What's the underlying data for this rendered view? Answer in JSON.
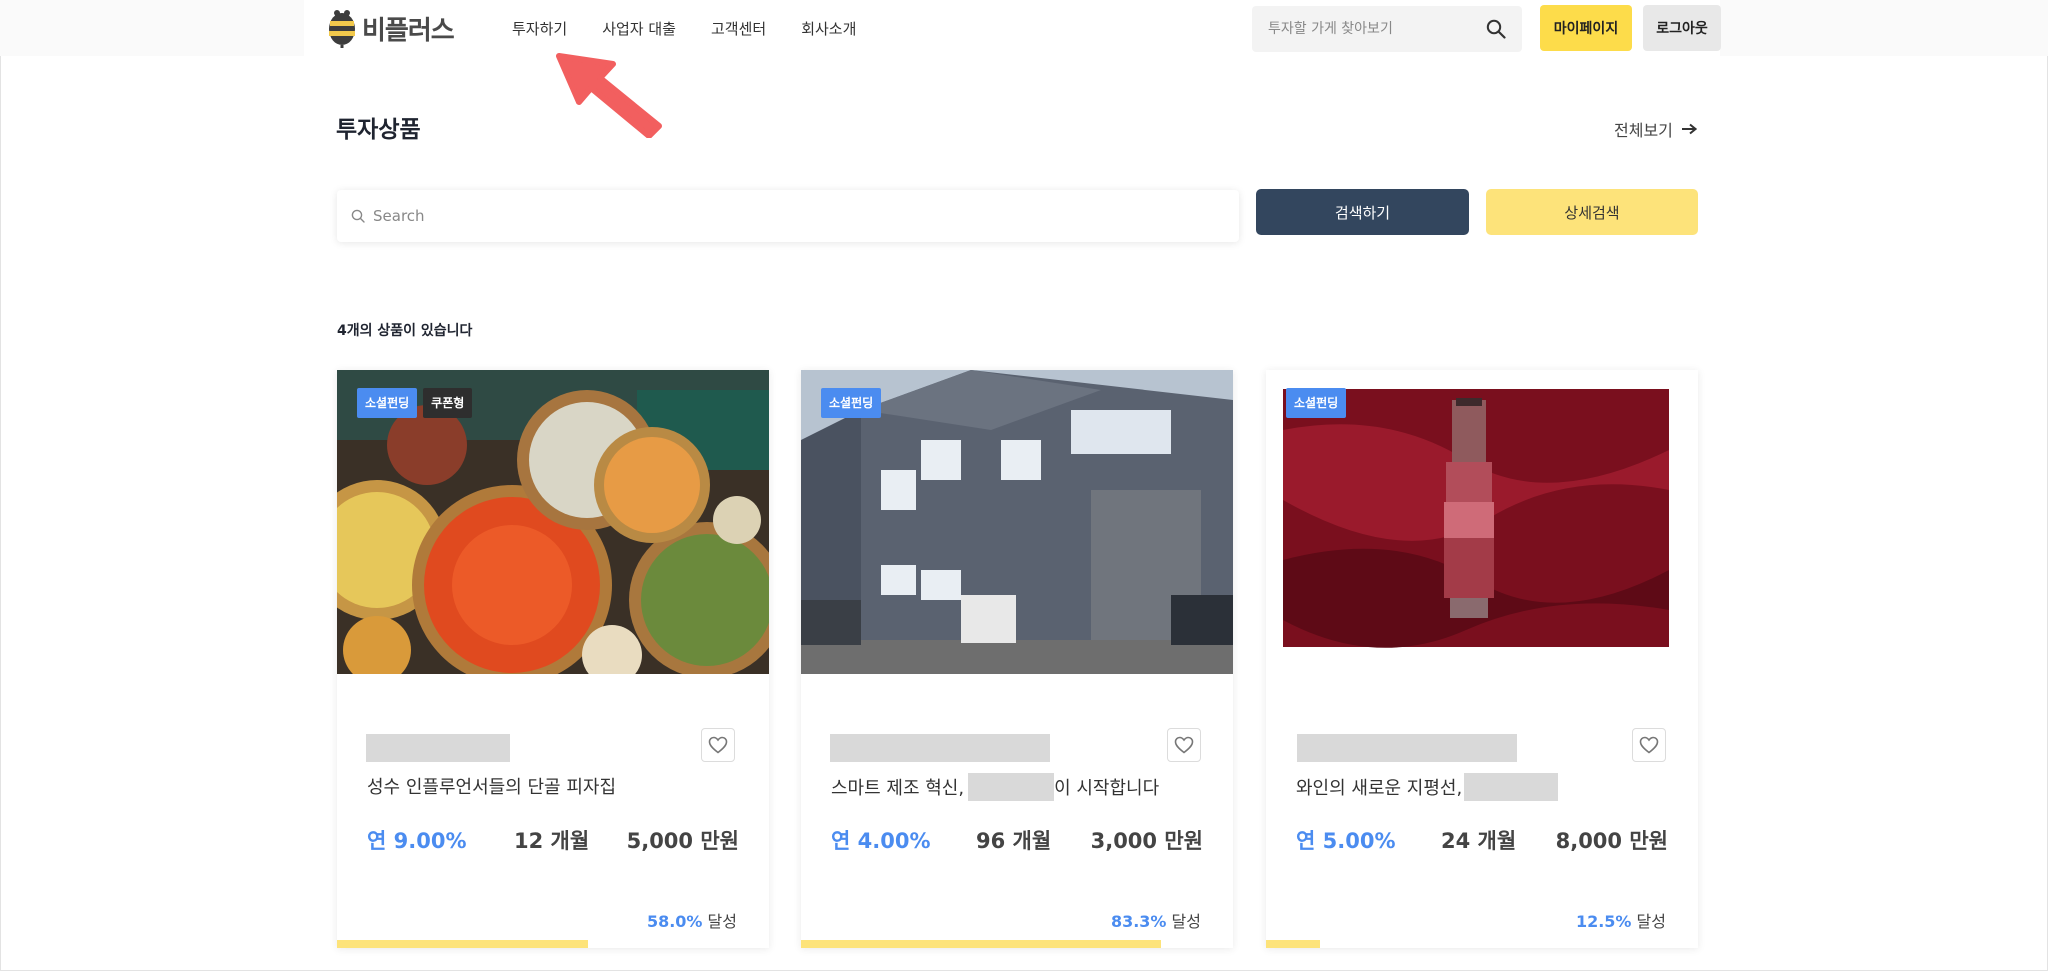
{
  "brand": {
    "name": "비플러스"
  },
  "nav": {
    "items": [
      "투자하기",
      "사업자 대출",
      "고객센터",
      "회사소개"
    ]
  },
  "top_search": {
    "placeholder": "투자할 가게 찾아보기"
  },
  "header_buttons": {
    "mypage": "마이페이지",
    "logout": "로그아웃"
  },
  "section": {
    "title": "투자상품",
    "view_all": "전체보기"
  },
  "main_search": {
    "placeholder": "Search",
    "search_button": "검색하기",
    "detail_button": "상세검색"
  },
  "result_count": "4개의 상품이 있습니다",
  "cards": [
    {
      "badges": [
        "소셜펀딩",
        "쿠폰형"
      ],
      "title": "성수 인플루언서들의 단골 피자집",
      "title_suffix": "",
      "rate": "연 9.00%",
      "term": "12 개월",
      "amount": "5,000 만원",
      "progress_pct": "58.0%",
      "progress_label": "달성",
      "progress_value": 0.58
    },
    {
      "badges": [
        "소셜펀딩"
      ],
      "title": "스마트 제조 혁신,",
      "title_suffix": "이 시작합니다",
      "rate": "연 4.00%",
      "term": "96 개월",
      "amount": "3,000 만원",
      "progress_pct": "83.3%",
      "progress_label": "달성",
      "progress_value": 0.833
    },
    {
      "badges": [
        "소셜펀딩"
      ],
      "title": "와인의 새로운 지평선,",
      "title_suffix": "",
      "rate": "연 5.00%",
      "term": "24 개월",
      "amount": "8,000 만원",
      "progress_pct": "12.5%",
      "progress_label": "달성",
      "progress_value": 0.125
    }
  ],
  "colors": {
    "accent_blue": "#4b8cf0",
    "brand_yellow": "#fddc4a",
    "progress_yellow": "#fde37a",
    "navy_button": "#33465e",
    "annotation_red": "#f25f5f"
  }
}
